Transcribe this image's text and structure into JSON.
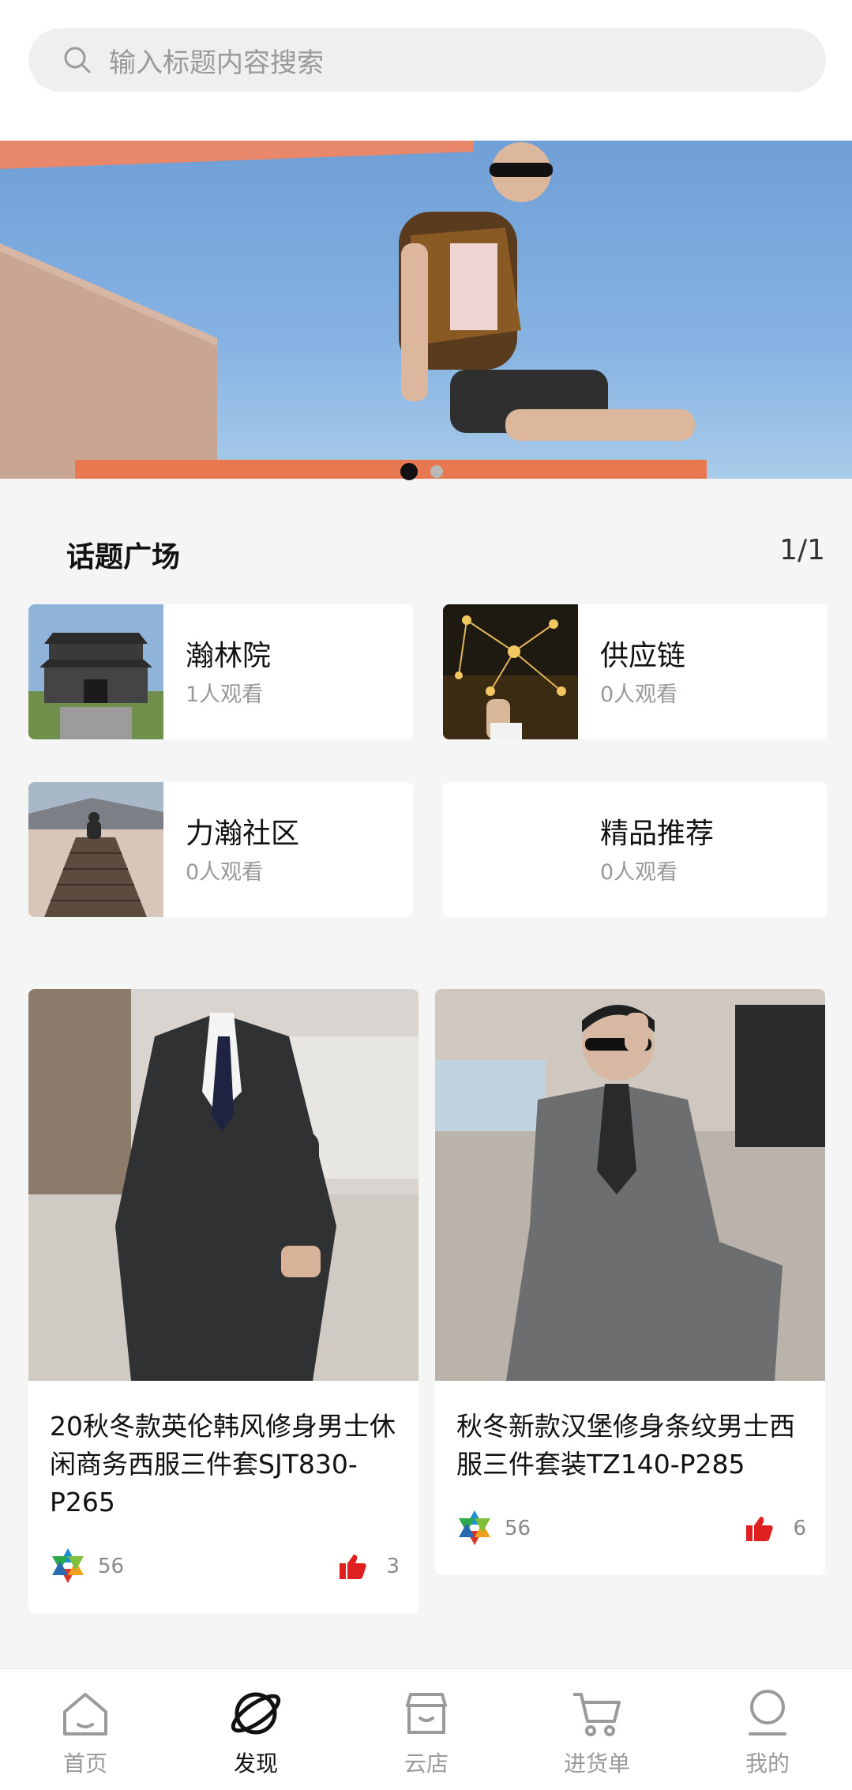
{
  "search": {
    "placeholder": "输入标题内容搜索",
    "icon": "search-icon"
  },
  "banner": {
    "slide_count": 2,
    "active_index": 0
  },
  "topics": {
    "title": "话题广场",
    "page_indicator": "1/1",
    "items": [
      {
        "name": "瀚林院",
        "views": "1人观看",
        "thumb": "building"
      },
      {
        "name": "供应链",
        "views": "0人观看",
        "thumb": "city-network"
      },
      {
        "name": "力瀚社区",
        "views": "0人观看",
        "thumb": "pier"
      },
      {
        "name": "精品推荐",
        "views": "0人观看",
        "thumb": ""
      }
    ]
  },
  "products": [
    {
      "title": "20秋冬款英伦韩风修身男士休闲商务西服三件套SJT830-P265",
      "count": "56",
      "likes": "3"
    },
    {
      "title": "秋冬新款汉堡修身条纹男士西服三件套装TZ140-P285",
      "count": "56",
      "likes": "6"
    }
  ],
  "tabbar": {
    "items": [
      {
        "label": "首页",
        "icon": "home-icon",
        "active": false
      },
      {
        "label": "发现",
        "icon": "planet-icon",
        "active": true
      },
      {
        "label": "云店",
        "icon": "store-icon",
        "active": false
      },
      {
        "label": "进货单",
        "icon": "cart-icon",
        "active": false
      },
      {
        "label": "我的",
        "icon": "profile-icon",
        "active": false
      }
    ]
  },
  "colors": {
    "accent": "#111111",
    "like_red": "#e02020",
    "background": "#f5f5f5"
  }
}
